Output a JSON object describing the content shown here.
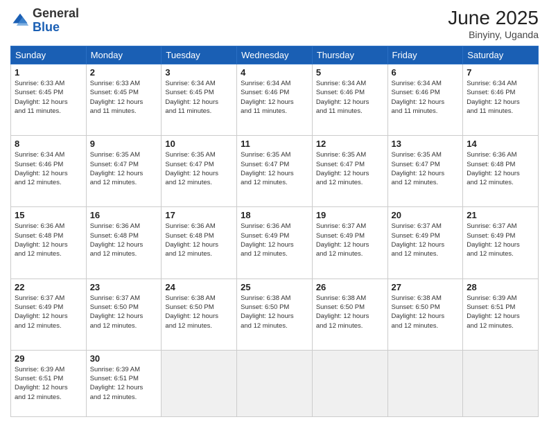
{
  "logo": {
    "general": "General",
    "blue": "Blue"
  },
  "header": {
    "month": "June 2025",
    "location": "Binyiny, Uganda"
  },
  "weekdays": [
    "Sunday",
    "Monday",
    "Tuesday",
    "Wednesday",
    "Thursday",
    "Friday",
    "Saturday"
  ],
  "weeks": [
    [
      {
        "day": "1",
        "sunrise": "6:33 AM",
        "sunset": "6:45 PM",
        "daylight": "12 hours and 11 minutes."
      },
      {
        "day": "2",
        "sunrise": "6:33 AM",
        "sunset": "6:45 PM",
        "daylight": "12 hours and 11 minutes."
      },
      {
        "day": "3",
        "sunrise": "6:34 AM",
        "sunset": "6:45 PM",
        "daylight": "12 hours and 11 minutes."
      },
      {
        "day": "4",
        "sunrise": "6:34 AM",
        "sunset": "6:46 PM",
        "daylight": "12 hours and 11 minutes."
      },
      {
        "day": "5",
        "sunrise": "6:34 AM",
        "sunset": "6:46 PM",
        "daylight": "12 hours and 11 minutes."
      },
      {
        "day": "6",
        "sunrise": "6:34 AM",
        "sunset": "6:46 PM",
        "daylight": "12 hours and 11 minutes."
      },
      {
        "day": "7",
        "sunrise": "6:34 AM",
        "sunset": "6:46 PM",
        "daylight": "12 hours and 11 minutes."
      }
    ],
    [
      {
        "day": "8",
        "sunrise": "6:34 AM",
        "sunset": "6:46 PM",
        "daylight": "12 hours and 12 minutes."
      },
      {
        "day": "9",
        "sunrise": "6:35 AM",
        "sunset": "6:47 PM",
        "daylight": "12 hours and 12 minutes."
      },
      {
        "day": "10",
        "sunrise": "6:35 AM",
        "sunset": "6:47 PM",
        "daylight": "12 hours and 12 minutes."
      },
      {
        "day": "11",
        "sunrise": "6:35 AM",
        "sunset": "6:47 PM",
        "daylight": "12 hours and 12 minutes."
      },
      {
        "day": "12",
        "sunrise": "6:35 AM",
        "sunset": "6:47 PM",
        "daylight": "12 hours and 12 minutes."
      },
      {
        "day": "13",
        "sunrise": "6:35 AM",
        "sunset": "6:47 PM",
        "daylight": "12 hours and 12 minutes."
      },
      {
        "day": "14",
        "sunrise": "6:36 AM",
        "sunset": "6:48 PM",
        "daylight": "12 hours and 12 minutes."
      }
    ],
    [
      {
        "day": "15",
        "sunrise": "6:36 AM",
        "sunset": "6:48 PM",
        "daylight": "12 hours and 12 minutes."
      },
      {
        "day": "16",
        "sunrise": "6:36 AM",
        "sunset": "6:48 PM",
        "daylight": "12 hours and 12 minutes."
      },
      {
        "day": "17",
        "sunrise": "6:36 AM",
        "sunset": "6:48 PM",
        "daylight": "12 hours and 12 minutes."
      },
      {
        "day": "18",
        "sunrise": "6:36 AM",
        "sunset": "6:49 PM",
        "daylight": "12 hours and 12 minutes."
      },
      {
        "day": "19",
        "sunrise": "6:37 AM",
        "sunset": "6:49 PM",
        "daylight": "12 hours and 12 minutes."
      },
      {
        "day": "20",
        "sunrise": "6:37 AM",
        "sunset": "6:49 PM",
        "daylight": "12 hours and 12 minutes."
      },
      {
        "day": "21",
        "sunrise": "6:37 AM",
        "sunset": "6:49 PM",
        "daylight": "12 hours and 12 minutes."
      }
    ],
    [
      {
        "day": "22",
        "sunrise": "6:37 AM",
        "sunset": "6:49 PM",
        "daylight": "12 hours and 12 minutes."
      },
      {
        "day": "23",
        "sunrise": "6:37 AM",
        "sunset": "6:50 PM",
        "daylight": "12 hours and 12 minutes."
      },
      {
        "day": "24",
        "sunrise": "6:38 AM",
        "sunset": "6:50 PM",
        "daylight": "12 hours and 12 minutes."
      },
      {
        "day": "25",
        "sunrise": "6:38 AM",
        "sunset": "6:50 PM",
        "daylight": "12 hours and 12 minutes."
      },
      {
        "day": "26",
        "sunrise": "6:38 AM",
        "sunset": "6:50 PM",
        "daylight": "12 hours and 12 minutes."
      },
      {
        "day": "27",
        "sunrise": "6:38 AM",
        "sunset": "6:50 PM",
        "daylight": "12 hours and 12 minutes."
      },
      {
        "day": "28",
        "sunrise": "6:39 AM",
        "sunset": "6:51 PM",
        "daylight": "12 hours and 12 minutes."
      }
    ],
    [
      {
        "day": "29",
        "sunrise": "6:39 AM",
        "sunset": "6:51 PM",
        "daylight": "12 hours and 12 minutes."
      },
      {
        "day": "30",
        "sunrise": "6:39 AM",
        "sunset": "6:51 PM",
        "daylight": "12 hours and 12 minutes."
      },
      null,
      null,
      null,
      null,
      null
    ]
  ],
  "labels": {
    "sunrise": "Sunrise:",
    "sunset": "Sunset:",
    "daylight": "Daylight: 12 hours"
  }
}
